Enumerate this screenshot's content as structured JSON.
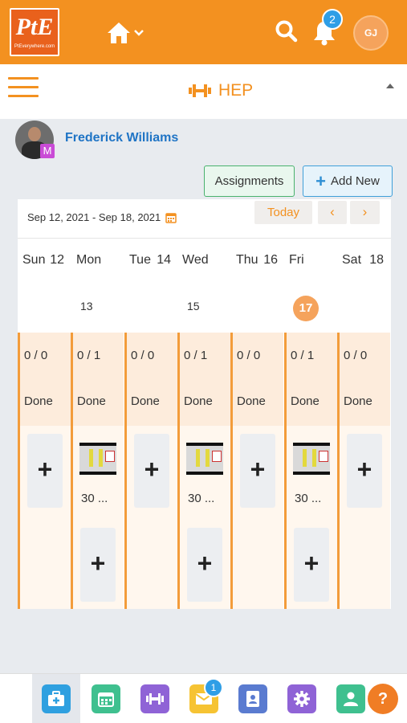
{
  "header": {
    "logo_text": "PtE",
    "logo_subtext": "PtEverywhere.com",
    "notification_count": "2",
    "user_initials": "GJ"
  },
  "section": {
    "title": "HEP"
  },
  "patient": {
    "name": "Frederick Williams",
    "badge": "M"
  },
  "actions": {
    "assignments_label": "Assignments",
    "add_new_label": "Add New"
  },
  "calendar": {
    "range": "Sep 12, 2021 - Sep 18, 2021",
    "today_label": "Today",
    "prev_label": "‹",
    "next_label": "›",
    "days": [
      {
        "name": "Sun",
        "date": "12",
        "count": "0 / 0",
        "status": "Done"
      },
      {
        "name": "Mon",
        "date": "13",
        "count": "0 / 1",
        "status": "Done",
        "exercise": "30 ..."
      },
      {
        "name": "Tue",
        "date": "14",
        "count": "0 / 0",
        "status": "Done"
      },
      {
        "name": "Wed",
        "date": "15",
        "count": "0 / 1",
        "status": "Done",
        "exercise": "30 ..."
      },
      {
        "name": "Thu",
        "date": "16",
        "count": "0 / 0",
        "status": "Done"
      },
      {
        "name": "Fri",
        "date": "17",
        "count": "0 / 1",
        "status": "Done",
        "exercise": "30 ..."
      },
      {
        "name": "Sat",
        "date": "18",
        "count": "0 / 0",
        "status": "Done"
      }
    ]
  },
  "bottom_nav": {
    "mail_badge": "1",
    "help_label": "?",
    "items": [
      {
        "icon": "medkit-icon",
        "color": "#2fa0e0"
      },
      {
        "icon": "calendar-icon",
        "color": "#3fc08f"
      },
      {
        "icon": "dumbbell-icon",
        "color": "#8f63d6"
      },
      {
        "icon": "mail-icon",
        "color": "#f6c333"
      },
      {
        "icon": "contacts-icon",
        "color": "#5a7bd0"
      },
      {
        "icon": "settings-icon",
        "color": "#8f63d6"
      },
      {
        "icon": "user-icon",
        "color": "#3fc08f"
      }
    ]
  },
  "colors": {
    "brand": "#f39120",
    "link": "#1f74c5",
    "accent_green": "#49b26d",
    "accent_blue": "#3f9fd9"
  }
}
